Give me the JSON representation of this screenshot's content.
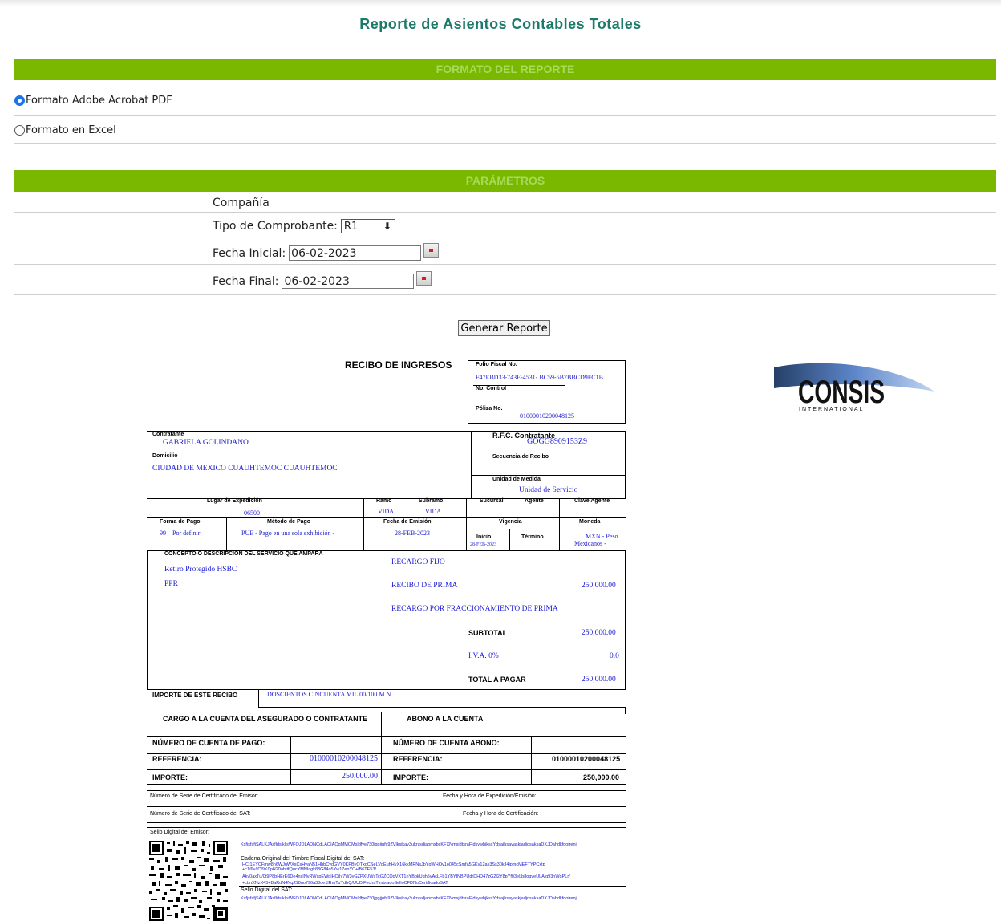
{
  "page": {
    "title": "Reporte de Asientos Contables Totales"
  },
  "format_section": {
    "header": "FORMATO DEL REPORTE",
    "options": [
      "Formato Adobe Acrobat PDF",
      "Formato en Excel"
    ],
    "selected": "Formato Adobe Acrobat PDF"
  },
  "params_section": {
    "header": "PARÁMETROS",
    "company_label": "Compañía",
    "tipo_label": "Tipo de Comprobante:",
    "tipo_value": "R1",
    "fecha_inicial_label": "Fecha Inicial:",
    "fecha_inicial_value": "06-02-2023",
    "fecha_final_label": "Fecha Final:",
    "fecha_final_value": "06-02-2023"
  },
  "generate_button": "Generar Reporte",
  "logo": {
    "name": "CONSIS",
    "sub": "INTERNATIONAL"
  },
  "receipt": {
    "title": "RECIBO DE INGRESOS",
    "folio_label": "Folio Fiscal No.",
    "folio_value": "F47EBD33-743E-4531- BC59-5B7BBCD9FC1B",
    "control_label": "No. Control",
    "poliza_label": "Póliza No.",
    "poliza_value": "01000010200048125",
    "contratante_label": "Contratante",
    "contratante_value": "GABRIELA GOLINDANO",
    "rfc_label": "R.F.C. Contratante",
    "rfc_value": "GOGG8909153Z9",
    "domicilio_label": "Domicilio",
    "domicilio_value": "CIUDAD DE MEXICO CUAUHTEMOC CUAUHTEMOC",
    "secuencia_label": "Secuencia de Recibo",
    "unidad_label": "Unidad de Medida",
    "unidad_value": "Unidad de Servicio",
    "lugar_label": "Lugar de Expedición",
    "lugar_value": "06500",
    "ramo_label": "Ramo",
    "ramo_value": "VIDA",
    "subramo_label": "Subramo",
    "subramo_value": "VIDA",
    "sucursal_label": "Sucursal",
    "agente_label": "Agente",
    "clave_label": "Clave Agente",
    "forma_label": "Forma de Pago",
    "forma_value": "99 – Por definir –",
    "metodo_label": "Método de Pago",
    "metodo_value": "PUE - Pago en una sola exhibición -",
    "fecha_emision_label": "Fecha de Emisión",
    "fecha_emision_value": "28-FEB-2023",
    "vigencia_label": "Vigencia",
    "inicio_label": "Inicio",
    "inicio_value": "28-FEB-2023",
    "termino_label": "Término",
    "moneda_label": "Moneda",
    "moneda_value1": "MXN - Peso",
    "moneda_value2": "Mexicanos -",
    "concepto_label": "CONCEPTO O DESCRIPCIÓN DEL SERVICIO QUE AMPARA",
    "concepto1": "Retiro Protegido HSBC",
    "concepto2": "PPR",
    "recargo_fijo": "RECARGO FIJO",
    "recibo_prima": "RECIBO DE PRIMA",
    "recibo_prima_value": "250,000.00",
    "recargo_fracc": "RECARGO POR FRACCIONAMIENTO DE PRIMA",
    "subtotal_label": "SUBTOTAL",
    "subtotal_value": "250,000.00",
    "iva_label": "I.V.A. 0%",
    "iva_value": "0.0",
    "total_label": "TOTAL A PAGAR",
    "total_value": "250,000.00",
    "importe_recibo_label": "IMPORTE DE ESTE RECIBO",
    "importe_recibo_value": "DOSCIENTOS CINCUENTA MIL 00/100 M.N.",
    "cargo_label": "CARGO A LA CUENTA DEL ASEGURADO O CONTRATANTE",
    "abono_label": "ABONO A LA CUENTA",
    "num_cuenta_pago_label": "NÚMERO DE CUENTA DE PAGO:",
    "num_cuenta_abono_label": "NÚMERO DE CUENTA ABONO:",
    "referencia_label": "REFERENCIA:",
    "referencia_value": "01000010200048125",
    "importe_label": "IMPORTE:",
    "importe_value": "250,000.00",
    "serie_emisor_label": "Número de Serie de Certificado del Emisor:",
    "fecha_expedicion_label": "Fecha y Hora de Expedición/Emisión:",
    "serie_sat_label": "Número de Serie de Certificado del SAT:",
    "fecha_cert_label": "Fecha y Hora de Certificación:",
    "sello_emisor_label": "Sello Digital del Emisor:",
    "sello_line1": "KsfjsfsfjSALKJAsfldsikljsWFOJDLADNCdLAOIAOgMMOMsldfye730jggjjufs9ZVlksikay3uknjsdjaomxbcKFXNmsjdtsraFjdsywhjkssYdsajhsayaskjadjdsaksaDXJDahdkfdoirenj",
    "cadena_label": "Cadena Original del Timbre Fiscal Digital del SAT:",
    "cadena1": "HCt1EYCFmw8n6WJuWXsCsHyaN51HbbCydGVY0KPByOTxgCSeLVgEuhHyX16kkMRNsJbYgWHQv1o045cSmfa5GKv12as3Ss30kJ4ipmcMEFTYPCxtp",
    "cadena2": "+c1/6v/fC/9K0pH20abttfQucYMNIcgk88G84o5Yw17enYC+iB6TE53/",
    "cadena3": "Aky0axTu/0t9P8bHErE6De4nsINvRWspEWplHOjIv7W3yGZPXUWsTcGZCQgVXT1nYBbkUqh5vAcLFb1YBYINBPUdrDHD47zG2I2Y8pYf03eLb8oqyeULAjq93nWqPLr/",
    "cadena4": "+cbnXNzX45+BaRdN4NqJS8no796a33oe1lRmTuYdbQ/UUDlFechaTimbradoSelloCFDNoCertificadoSAT",
    "sello_sat_label": "Sello Digital del SAT:",
    "sello_sat_line": "KsfjsfsfjSALKJAsfldsikljsWFOJDLADNCdLAOIAOgMMOMsldfye730jggjjufs9ZVlksikay3uknjsdjaomxbcKFXNmsjdtsraFjdsywhjkssYdsajhsayaskjadjdsaksaDXJDahdkfdoirenj"
  }
}
